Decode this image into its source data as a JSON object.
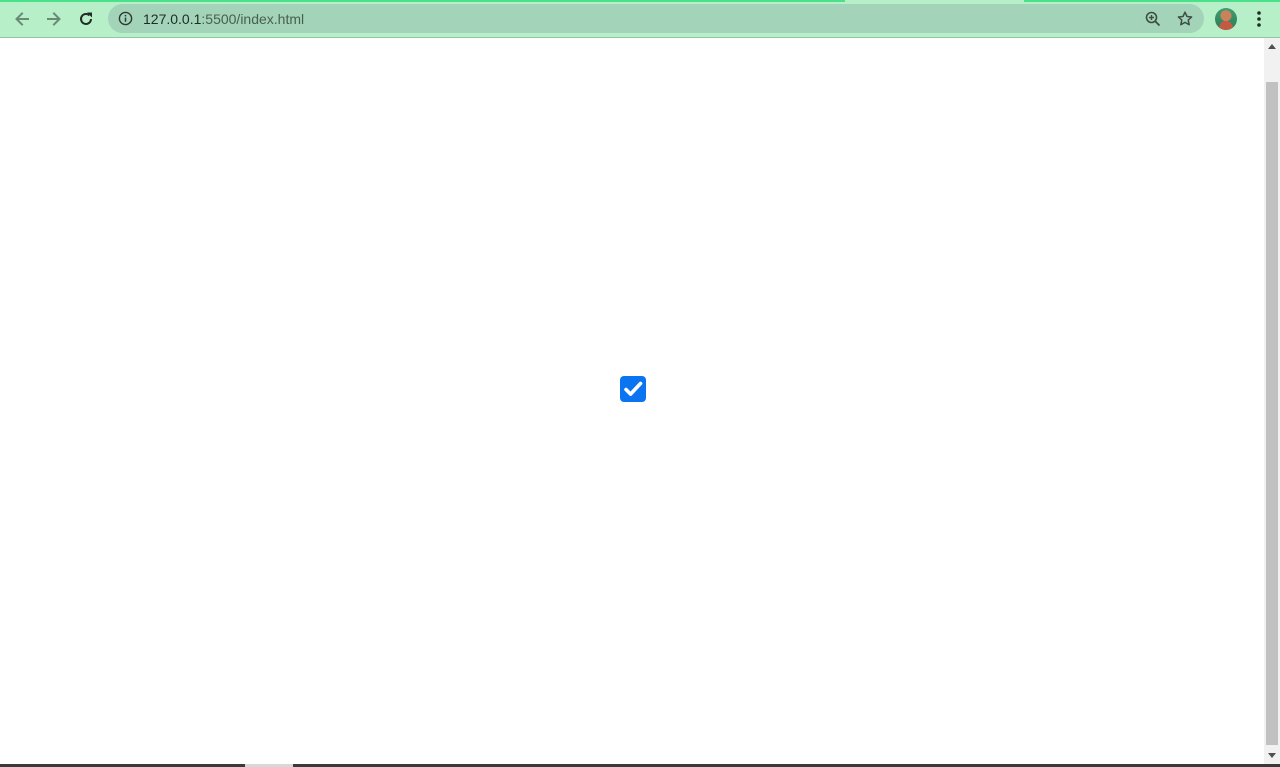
{
  "browser": {
    "url_host": "127.0.0.1",
    "url_port_path": ":5500/index.html",
    "icons": {
      "back": "arrow-left-icon",
      "forward": "arrow-right-icon",
      "reload": "reload-icon",
      "site_info": "info-icon",
      "zoom": "zoom-in-icon",
      "bookmark": "star-icon",
      "profile": "avatar",
      "menu": "kebab-menu-icon"
    }
  },
  "page": {
    "checkbox": {
      "checked": true,
      "color": "#0b74f0"
    }
  },
  "colors": {
    "toolbar": "#b7efc9",
    "omnibox": "#a3d3b9",
    "progress": "#4be08a"
  }
}
